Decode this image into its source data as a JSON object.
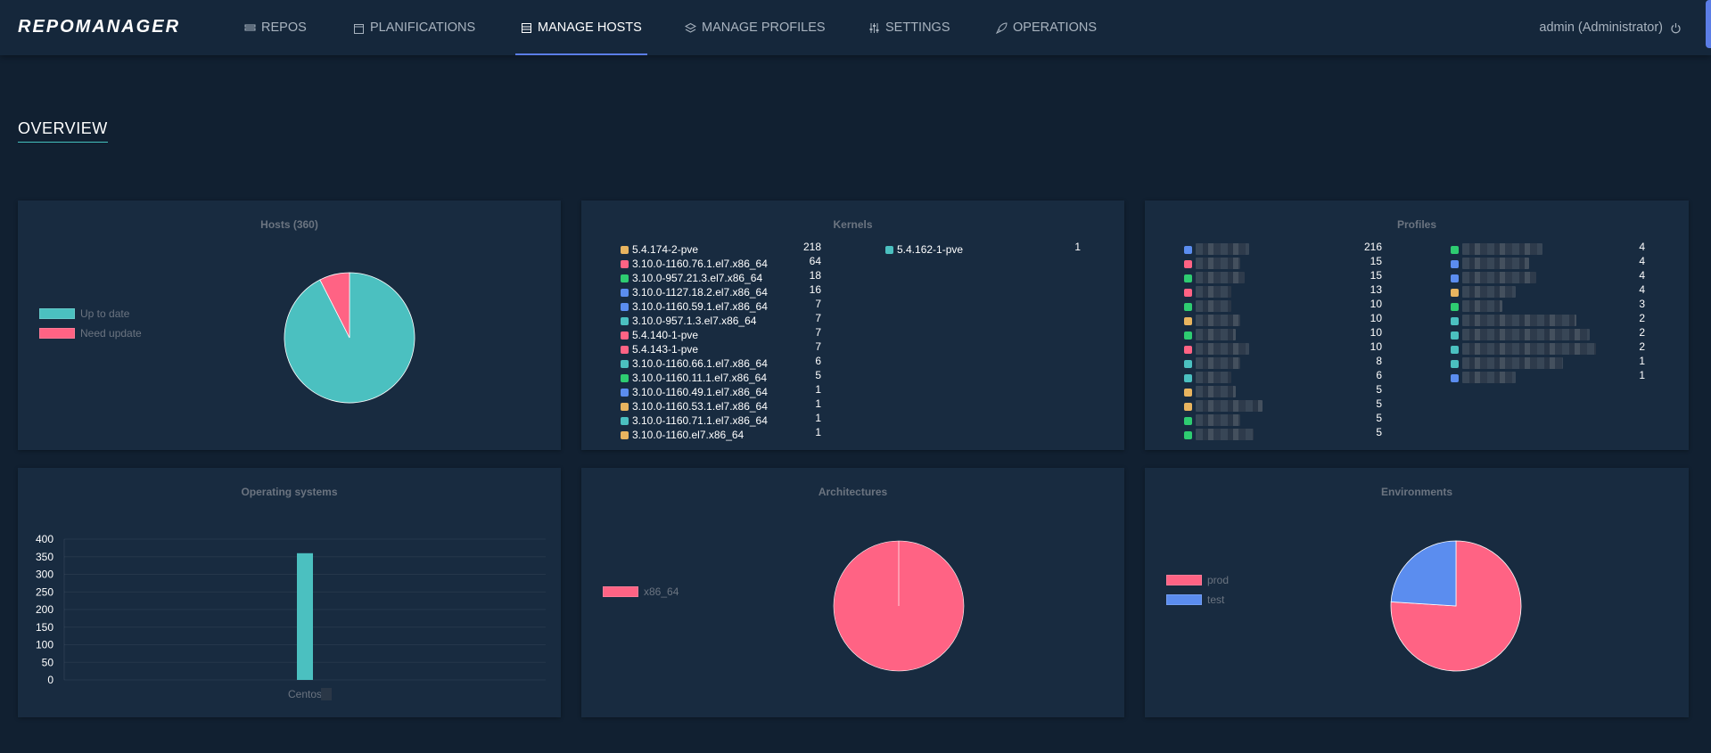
{
  "nav": {
    "logo": "REPOMANAGER",
    "items": [
      {
        "label": "REPOS",
        "icon": "repos-icon"
      },
      {
        "label": "PLANIFICATIONS",
        "icon": "calendar-icon"
      },
      {
        "label": "MANAGE HOSTS",
        "icon": "server-icon"
      },
      {
        "label": "MANAGE PROFILES",
        "icon": "layers-icon"
      },
      {
        "label": "SETTINGS",
        "icon": "sliders-icon"
      },
      {
        "label": "OPERATIONS",
        "icon": "rocket-icon"
      }
    ],
    "active": "MANAGE HOSTS",
    "user": "admin (Administrator)",
    "logout_icon": "power-icon"
  },
  "overview_title": "OVERVIEW",
  "colors": {
    "teal": "#4bc0c0",
    "pink": "#ff6384",
    "green": "#2ecc71",
    "blue": "#5b8def",
    "orange": "#e8b45f"
  },
  "hosts": {
    "title": "Hosts (360)",
    "legend": [
      {
        "label": "Up to date",
        "color": "#4bc0c0"
      },
      {
        "label": "Need update",
        "color": "#ff6384"
      }
    ],
    "slices": [
      {
        "label": "Up to date",
        "value": 0.925,
        "color": "#4bc0c0"
      },
      {
        "label": "Need update",
        "value": 0.075,
        "color": "#ff6384"
      }
    ]
  },
  "kernels": {
    "title": "Kernels",
    "col1": [
      {
        "name": "5.4.174-2-pve",
        "count": "218",
        "color": "#e8b45f"
      },
      {
        "name": "3.10.0-1160.76.1.el7.x86_64",
        "count": "64",
        "color": "#ff6384"
      },
      {
        "name": "3.10.0-957.21.3.el7.x86_64",
        "count": "18",
        "color": "#2ecc71"
      },
      {
        "name": "3.10.0-1127.18.2.el7.x86_64",
        "count": "16",
        "color": "#5b8def"
      },
      {
        "name": "3.10.0-1160.59.1.el7.x86_64",
        "count": "7",
        "color": "#5b8def"
      },
      {
        "name": "3.10.0-957.1.3.el7.x86_64",
        "count": "7",
        "color": "#4bc0c0"
      },
      {
        "name": "5.4.140-1-pve",
        "count": "7",
        "color": "#ff6384"
      },
      {
        "name": "5.4.143-1-pve",
        "count": "7",
        "color": "#ff6384"
      },
      {
        "name": "3.10.0-1160.66.1.el7.x86_64",
        "count": "6",
        "color": "#4bc0c0"
      },
      {
        "name": "3.10.0-1160.11.1.el7.x86_64",
        "count": "5",
        "color": "#2ecc71"
      },
      {
        "name": "3.10.0-1160.49.1.el7.x86_64",
        "count": "1",
        "color": "#5b8def"
      },
      {
        "name": "3.10.0-1160.53.1.el7.x86_64",
        "count": "1",
        "color": "#e8b45f"
      },
      {
        "name": "3.10.0-1160.71.1.el7.x86_64",
        "count": "1",
        "color": "#4bc0c0"
      },
      {
        "name": "3.10.0-1160.el7.x86_64",
        "count": "1",
        "color": "#e8b45f"
      }
    ],
    "col2": [
      {
        "name": "5.4.162-1-pve",
        "count": "1",
        "color": "#4bc0c0"
      }
    ]
  },
  "profiles": {
    "title": "Profiles",
    "col1": [
      {
        "count": "216",
        "color": "#5b8def",
        "blur": 0.6
      },
      {
        "count": "15",
        "color": "#ff6384",
        "blur": 0.5
      },
      {
        "count": "15",
        "color": "#2ecc71",
        "blur": 0.55
      },
      {
        "count": "13",
        "color": "#ff6384",
        "blur": 0.4
      },
      {
        "count": "10",
        "color": "#2ecc71",
        "blur": 0.4
      },
      {
        "count": "10",
        "color": "#e8b45f",
        "blur": 0.5
      },
      {
        "count": "10",
        "color": "#2ecc71",
        "blur": 0.45
      },
      {
        "count": "10",
        "color": "#ff6384",
        "blur": 0.6
      },
      {
        "count": "8",
        "color": "#4bc0c0",
        "blur": 0.5
      },
      {
        "count": "6",
        "color": "#4bc0c0",
        "blur": 0.4
      },
      {
        "count": "5",
        "color": "#e8b45f",
        "blur": 0.45
      },
      {
        "count": "5",
        "color": "#e8b45f",
        "blur": 0.75
      },
      {
        "count": "5",
        "color": "#2ecc71",
        "blur": 0.5
      },
      {
        "count": "5",
        "color": "#2ecc71",
        "blur": 0.65
      }
    ],
    "col2": [
      {
        "count": "4",
        "color": "#2ecc71",
        "blur": 0.6
      },
      {
        "count": "4",
        "color": "#5b8def",
        "blur": 0.5
      },
      {
        "count": "4",
        "color": "#5b8def",
        "blur": 0.55
      },
      {
        "count": "4",
        "color": "#e8b45f",
        "blur": 0.4
      },
      {
        "count": "3",
        "color": "#2ecc71",
        "blur": 0.3
      },
      {
        "count": "2",
        "color": "#4bc0c0",
        "blur": 0.85
      },
      {
        "count": "2",
        "color": "#4bc0c0",
        "blur": 0.95
      },
      {
        "count": "2",
        "color": "#4bc0c0",
        "blur": 1.0
      },
      {
        "count": "1",
        "color": "#4bc0c0",
        "blur": 0.75
      },
      {
        "count": "1",
        "color": "#5b8def",
        "blur": 0.4
      }
    ]
  },
  "os": {
    "title": "Operating systems",
    "chart_data": {
      "type": "bar",
      "categories": [
        "Centos"
      ],
      "values": [
        360
      ],
      "ylim": [
        0,
        400
      ],
      "yticks": [
        0,
        50,
        100,
        150,
        200,
        250,
        300,
        350,
        400
      ],
      "color": "#4bc0c0"
    }
  },
  "arch": {
    "title": "Architectures",
    "legend": [
      {
        "label": "x86_64",
        "color": "#ff6384"
      }
    ],
    "slices": [
      {
        "label": "x86_64",
        "value": 1.0,
        "color": "#ff6384"
      }
    ]
  },
  "env": {
    "title": "Environments",
    "legend": [
      {
        "label": "prod",
        "color": "#ff6384"
      },
      {
        "label": "test",
        "color": "#5b8def"
      }
    ],
    "slices": [
      {
        "label": "prod",
        "value": 0.76,
        "color": "#ff6384"
      },
      {
        "label": "test",
        "value": 0.24,
        "color": "#5b8def"
      }
    ]
  }
}
